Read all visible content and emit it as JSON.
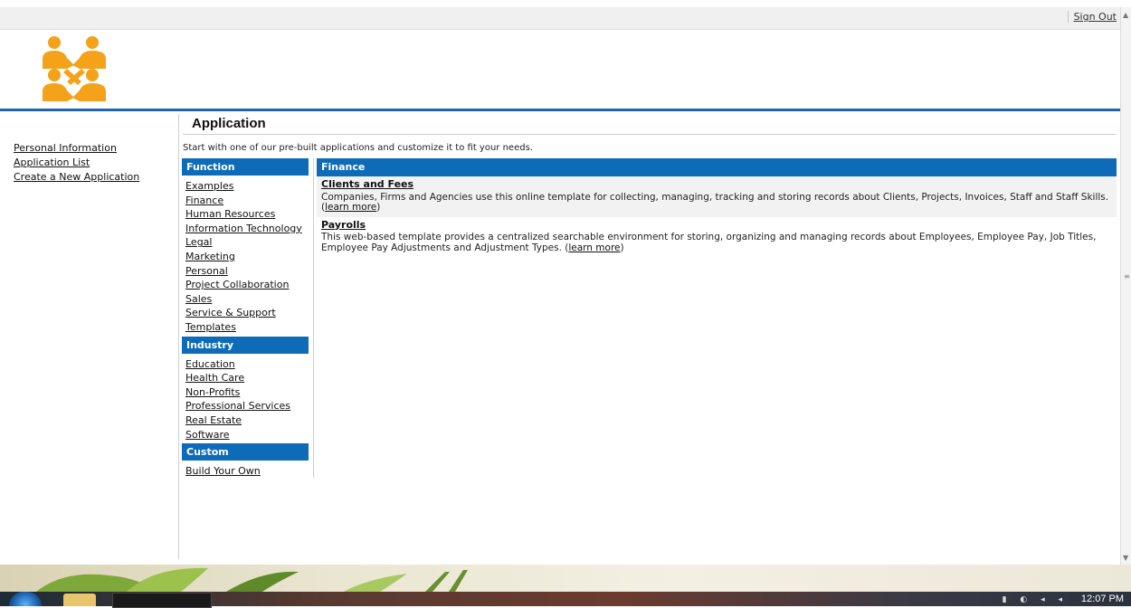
{
  "header": {
    "sign_out": "Sign Out"
  },
  "logo": {
    "icon": "people-network-logo",
    "color": "#f3a21a"
  },
  "left_nav": {
    "links": [
      "Personal Information",
      "Application List",
      "Create a New Application"
    ]
  },
  "main": {
    "title": "Application",
    "intro": "Start with one of our pre-built applications and customize it to fit your needs.",
    "function_header": "Function",
    "functions": [
      "Examples",
      "Finance",
      "Human Resources",
      "Information Technology",
      "Legal",
      "Marketing",
      "Personal",
      "Project Collaboration",
      "Sales",
      "Service & Support",
      "Templates"
    ],
    "industry_header": "Industry",
    "industries": [
      "Education",
      "Health Care",
      "Non-Profits",
      "Professional Services",
      "Real Estate",
      "Software"
    ],
    "custom_header": "Custom",
    "custom": [
      "Build Your Own"
    ],
    "category_header": "Finance",
    "templates": [
      {
        "title": "Clients and Fees",
        "description": "Companies, Firms and Agencies use this online template for collecting, managing, tracking and storing records about Clients, Projects, Invoices, Staff and Staff Skills.",
        "learn_more": "learn more"
      },
      {
        "title": "Payrolls",
        "description": "This web-based template provides a centralized searchable environment for storing, organizing and managing records about Employees, Employee Pay, Job Titles, Employee Pay Adjustments and Adjustment Types.",
        "learn_more": "learn more"
      }
    ]
  },
  "taskbar": {
    "clock": "12:07 PM"
  },
  "colors": {
    "accent": "#0e6bb7",
    "rule": "#1f64ad"
  }
}
